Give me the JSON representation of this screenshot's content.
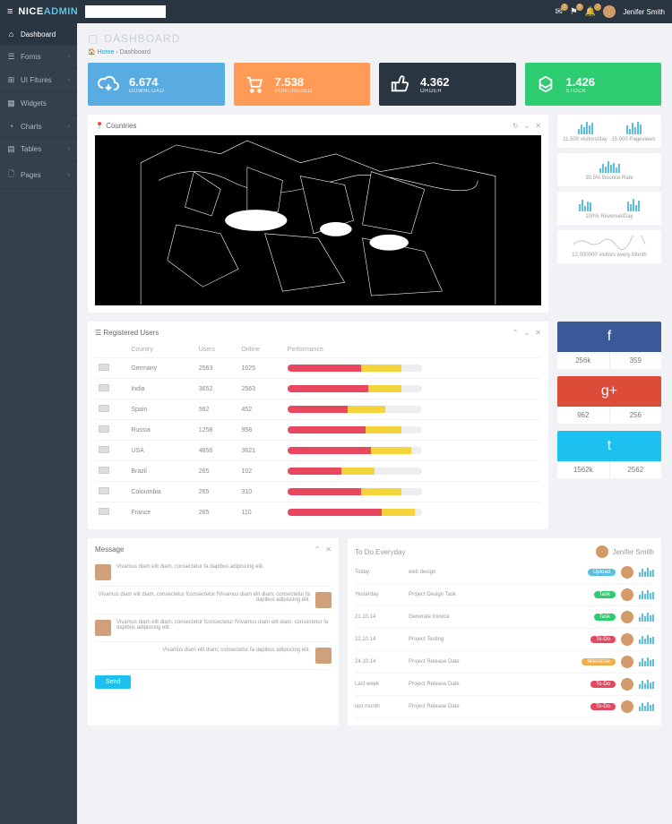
{
  "brand": {
    "p1": "NICE",
    "p2": "ADMIN"
  },
  "header": {
    "notifications": [
      {
        "count": "2"
      },
      {
        "count": "5"
      },
      {
        "count": "7"
      }
    ],
    "user": "Jenifer Smith"
  },
  "sidebar": {
    "items": [
      {
        "icon": "⌂",
        "label": "Dashboard"
      },
      {
        "icon": "☰",
        "label": "Forms"
      },
      {
        "icon": "⊞",
        "label": "UI Fitures"
      },
      {
        "icon": "▦",
        "label": "Widgets"
      },
      {
        "icon": "◔",
        "label": "Charts"
      },
      {
        "icon": "▤",
        "label": "Tables"
      },
      {
        "icon": "🗋",
        "label": "Pages"
      }
    ]
  },
  "page": {
    "title": "DASHBOARD",
    "crumb_home": "Home",
    "crumb_cur": "Dashboard"
  },
  "stats": [
    {
      "value": "6.674",
      "label": "DOWNLOAD"
    },
    {
      "value": "7.538",
      "label": "PURCHASED"
    },
    {
      "value": "4.362",
      "label": "ORDER"
    },
    {
      "value": "1.426",
      "label": "STOCK"
    }
  ],
  "countries": {
    "title": "Countries"
  },
  "mini": [
    {
      "text": "11,500 visitors/day"
    },
    {
      "text": "15,000 Pageviews"
    },
    {
      "text": "30.5% Bounce Rate"
    },
    {
      "text": "100% Revenue/Day"
    },
    {
      "text": "12,000000 visitors every Month"
    }
  ],
  "users": {
    "title": "Registered Users",
    "cols": [
      "",
      "Country",
      "Users",
      "Online",
      "Performance"
    ],
    "rows": [
      {
        "country": "Germany",
        "users": "2563",
        "online": "1025",
        "p1": 55,
        "p2": 30
      },
      {
        "country": "India",
        "users": "3652",
        "online": "2563",
        "p1": 60,
        "p2": 25
      },
      {
        "country": "Spain",
        "users": "562",
        "online": "452",
        "p1": 45,
        "p2": 28
      },
      {
        "country": "Russia",
        "users": "1258",
        "online": "958",
        "p1": 58,
        "p2": 27
      },
      {
        "country": "USA",
        "users": "4856",
        "online": "3621",
        "p1": 62,
        "p2": 30
      },
      {
        "country": "Brazil",
        "users": "265",
        "online": "102",
        "p1": 40,
        "p2": 25
      },
      {
        "country": "Coloumbia",
        "users": "265",
        "online": "310",
        "p1": 55,
        "p2": 30
      },
      {
        "country": "France",
        "users": "265",
        "online": "110",
        "p1": 70,
        "p2": 25
      }
    ]
  },
  "social": [
    {
      "cls": "fb",
      "icon": "f",
      "a": "256k",
      "b": "359"
    },
    {
      "cls": "gp",
      "icon": "g+",
      "a": "962",
      "b": "256"
    },
    {
      "cls": "tw",
      "icon": "t",
      "a": "1562k",
      "b": "2562"
    }
  ],
  "messages": {
    "title": "Message",
    "items": [
      {
        "text": "Vivamus diam elit diam, consectetur fa dapibus adipiscing elit."
      },
      {
        "text": "Vivamus diam elit diam, consectetur fconsectetur fVivamus diam elit diam, consectetur fa dapibus adipiscing elit."
      },
      {
        "text": "Vivamus diam elit diam, consectetur fconsectetur fVivamus diam elit diam, consectetur fa dapibus adipiscing elit."
      },
      {
        "text": "Vivamus diam elit diam, consectetur fa dapibus adipiscing elit."
      }
    ],
    "send": "Send"
  },
  "todo": {
    "title": "To Do Everyday",
    "user": "Jenifer Smith",
    "rows": [
      {
        "date": "Today",
        "task": "web design",
        "tag": "Upload",
        "tcls": "t-up"
      },
      {
        "date": "Yesterday",
        "task": "Project Design Task",
        "tag": "Task",
        "tcls": "t-task"
      },
      {
        "date": "21.10.14",
        "task": "Generate Invoice",
        "tag": "Task",
        "tcls": "t-task"
      },
      {
        "date": "22.10.14",
        "task": "Project Testing",
        "tag": "To-Do",
        "tcls": "t-todo"
      },
      {
        "date": "24.10.14",
        "task": "Project Release Date",
        "tag": "Milestone",
        "tcls": "t-mile"
      },
      {
        "date": "Last week",
        "task": "Project Release Date",
        "tag": "To-Do",
        "tcls": "t-todo"
      },
      {
        "date": "last month",
        "task": "Project Release Date",
        "tag": "To-Do",
        "tcls": "t-todo"
      }
    ]
  }
}
